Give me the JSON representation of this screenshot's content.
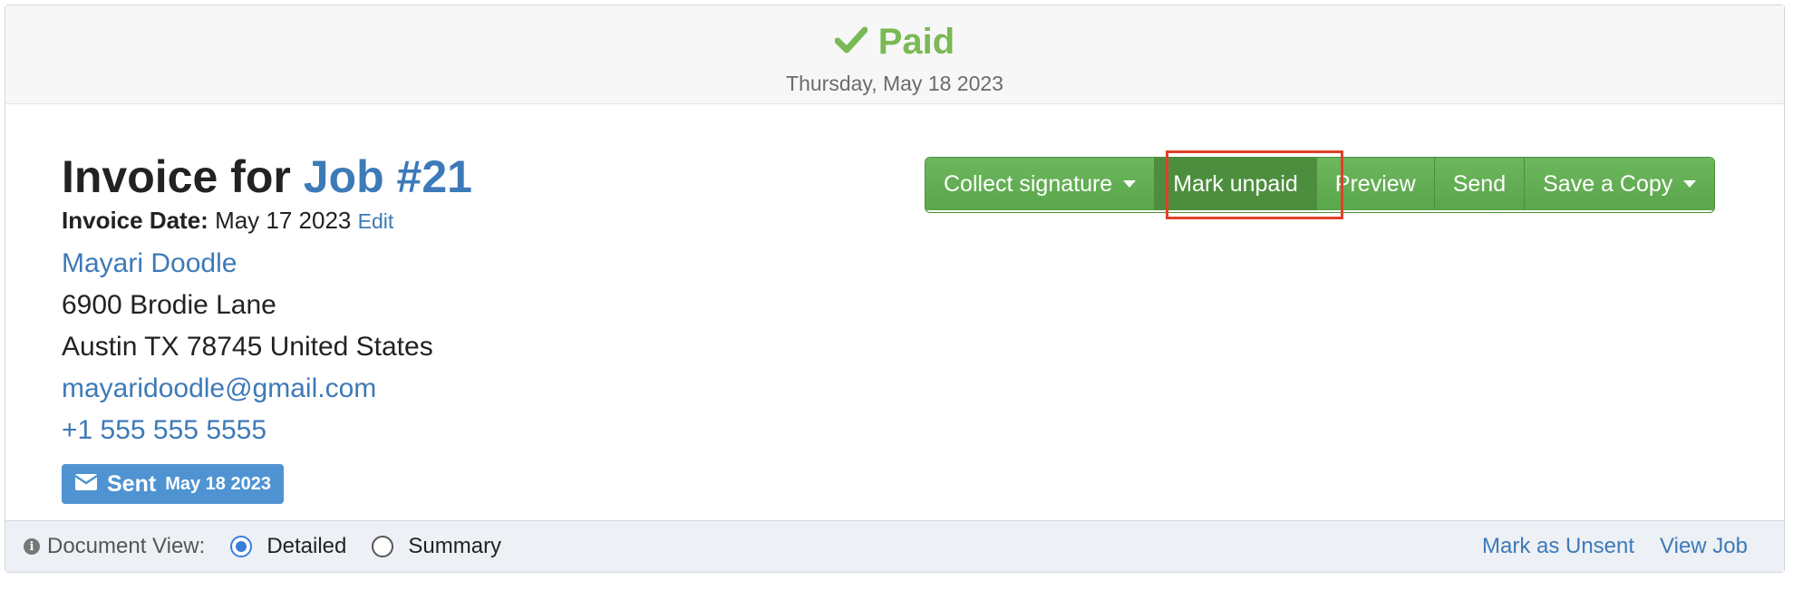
{
  "status": {
    "label": "Paid",
    "date": "Thursday, May 18 2023",
    "color": "#7ab955",
    "icon": "checkmark-icon"
  },
  "invoice": {
    "title_prefix": "Invoice for",
    "job_link": "Job #21",
    "date_label": "Invoice Date:",
    "date_value": "May 17 2023",
    "edit_label": "Edit"
  },
  "client": {
    "name": "Mayari Doodle",
    "address1": "6900 Brodie Lane",
    "address2": "Austin TX 78745 United States",
    "email": "mayaridoodle@gmail.com",
    "phone": "+1 555 555 5555"
  },
  "sent_badge": {
    "label": "Sent",
    "date": "May 18 2023",
    "icon": "envelope-icon",
    "color": "#4f93d2"
  },
  "actions": {
    "collect_signature": "Collect signature",
    "mark_unpaid": "Mark unpaid",
    "preview": "Preview",
    "send": "Send",
    "save_copy": "Save a Copy",
    "color": "#5fab50",
    "highlight_color": "#e0402b"
  },
  "footer": {
    "view_label": "Document View:",
    "option_detailed": "Detailed",
    "option_summary": "Summary",
    "selected": "Detailed",
    "mark_unsent": "Mark as Unsent",
    "view_job": "View Job"
  }
}
